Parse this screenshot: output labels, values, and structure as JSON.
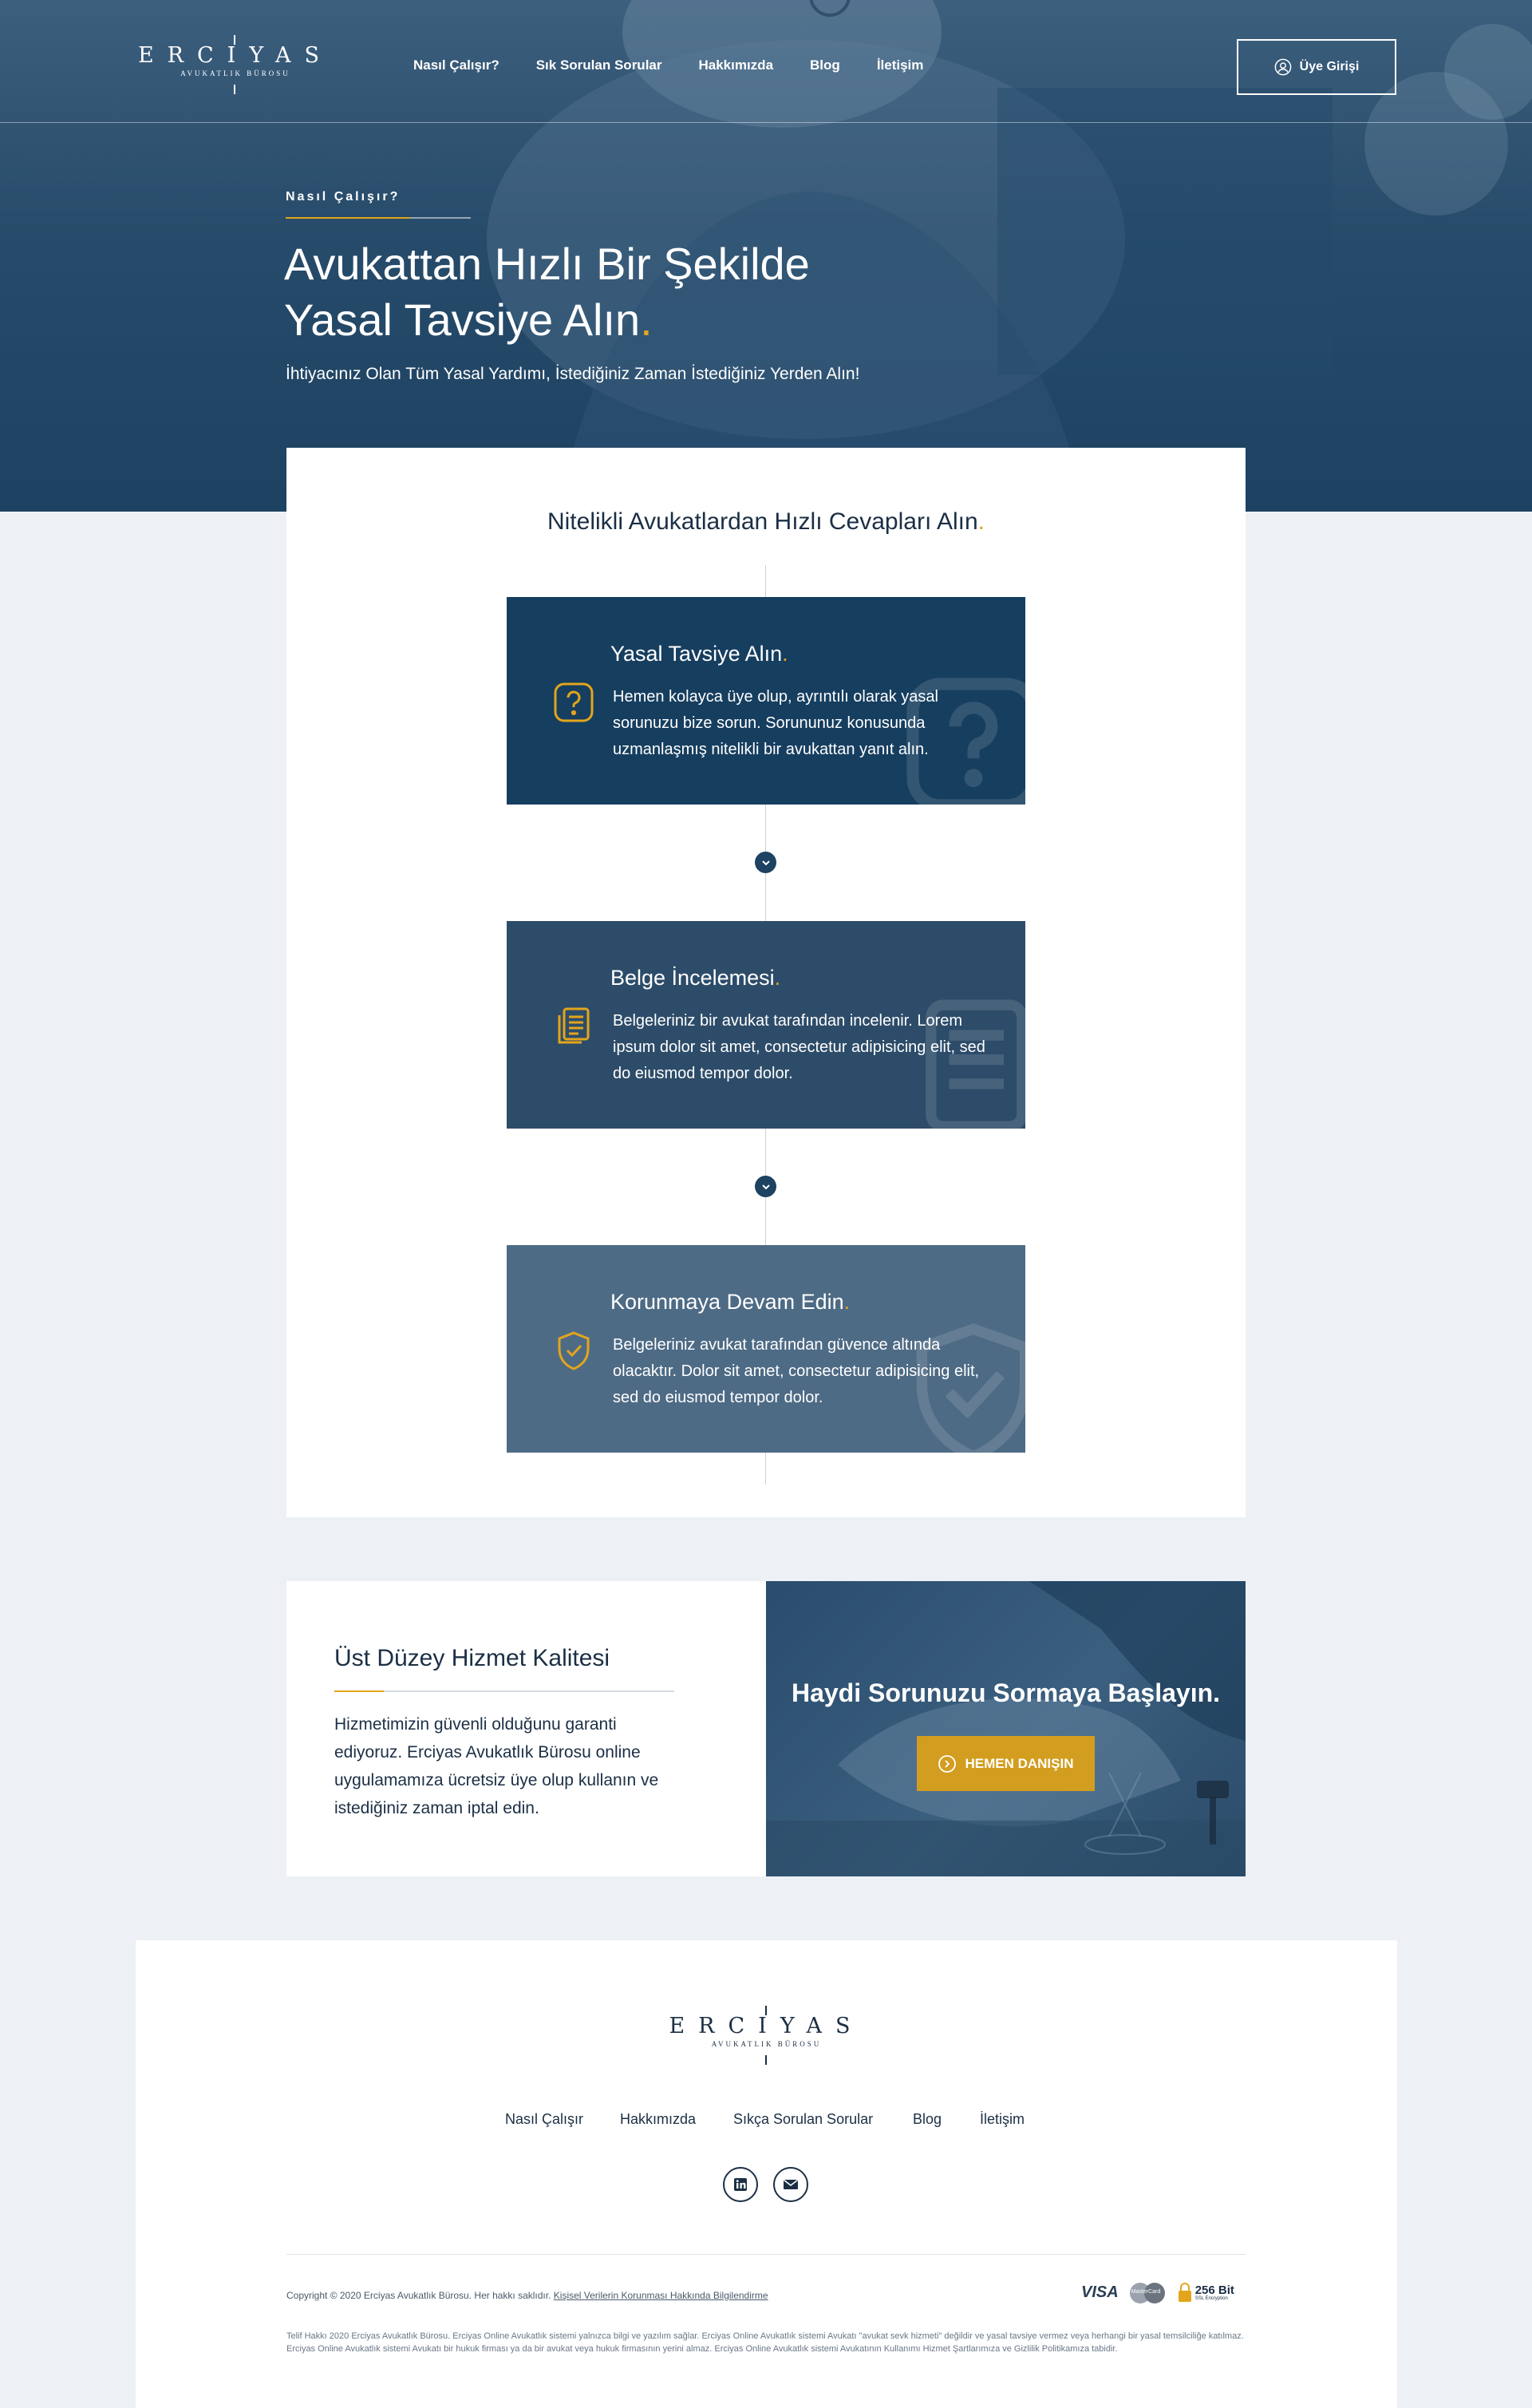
{
  "header": {
    "logo_word": "ERCIYAS",
    "logo_sub": "AVUKATLIK BÜROSU",
    "nav": [
      "Nasıl Çalışır?",
      "Sık Sorulan Sorular",
      "Hakkımızda",
      "Blog",
      "İletişim"
    ],
    "member_login": "Üye Girişi"
  },
  "hero": {
    "eyebrow": "Nasıl Çalışır?",
    "title_line1": "Avukattan Hızlı Bir Şekilde",
    "title_line2": "Yasal Tavsiye Alın",
    "title_dot": ".",
    "subtitle": "İhtiyacınız Olan Tüm Yasal Yardımı, İstediğiniz Zaman İstediğiniz Yerden Alın!"
  },
  "steps": {
    "title": "Nitelikli Avukatlardan Hızlı Cevapları Alın",
    "dot": ".",
    "items": [
      {
        "title": "Yasal Tavsiye Alın",
        "text": "Hemen kolayca üye olup, ayrıntılı olarak yasal sorunuzu bize sorun. Sorununuz konusunda uzmanlaşmış nitelikli bir avukattan yanıt alın.",
        "icon": "question-icon",
        "color": "#163e5f"
      },
      {
        "title": "Belge İncelemesi",
        "text": "Belgeleriniz bir avukat tarafından incelenir. Lorem ipsum dolor sit amet, consectetur adipisicing elit, sed do eiusmod tempor dolor.",
        "icon": "documents-icon",
        "color": "#2d4c69"
      },
      {
        "title": "Korunmaya Devam Edin",
        "text": "Belgeleriniz avukat tarafından güvence altında olacaktır. Dolor sit amet, consectetur adipisicing elit, sed do eiusmod tempor dolor.",
        "icon": "shield-check-icon",
        "color": "#4e6b85"
      }
    ]
  },
  "quality": {
    "title": "Üst Düzey Hizmet Kalitesi",
    "text": "Hizmetimizin güvenli olduğunu garanti ediyoruz. Erciyas Avukatlık Bürosu online uygulamamıza ücretsiz üye olup kullanın ve istediğiniz zaman iptal edin."
  },
  "cta": {
    "title": "Haydi Sorunuzu Sormaya Başlayın.",
    "button": "HEMEN DANIŞIN"
  },
  "footer": {
    "nav": [
      "Nasıl Çalışır",
      "Hakkımızda",
      "Sıkça Sorulan Sorular",
      "Blog",
      "İletişim"
    ],
    "social": [
      "linkedin-icon",
      "mail-icon"
    ],
    "copyright": "Copyright © 2020 Erciyas Avukatlık Bürosu. Her hakkı saklıdır.",
    "kvkk_link": "Kişisel Verilerin Korunması Hakkında Bilgilendirme",
    "payments": {
      "visa": "VISA",
      "mastercard": "MasterCard",
      "ssl_bits": "256 Bit",
      "ssl_sub": "SSL Encryption"
    },
    "legal": "Telif Hakkı 2020 Erciyas Avukatlık Bürosu. Erciyas Online Avukatlık sistemi yalnızca bilgi ve yazılım sağlar. Erciyas Online Avukatlık sistemi Avukatı \"avukat sevk hizmeti\" değildir ve yasal tavsiye vermez veya herhangi bir yasal temsilciliğe katılmaz. Erciyas Online Avukatlık sistemi Avukatı bir hukuk firması ya da bir avukat veya hukuk firmasının yerini almaz. Erciyas Online Avukatlık sistemi Avukatının Kullanımı Hizmet Şartlarımıza ve Gizlilik Politikamıza tabidir."
  },
  "colors": {
    "navy": "#1d4262",
    "gold": "#e3a51c",
    "bg": "#edf1f5"
  }
}
